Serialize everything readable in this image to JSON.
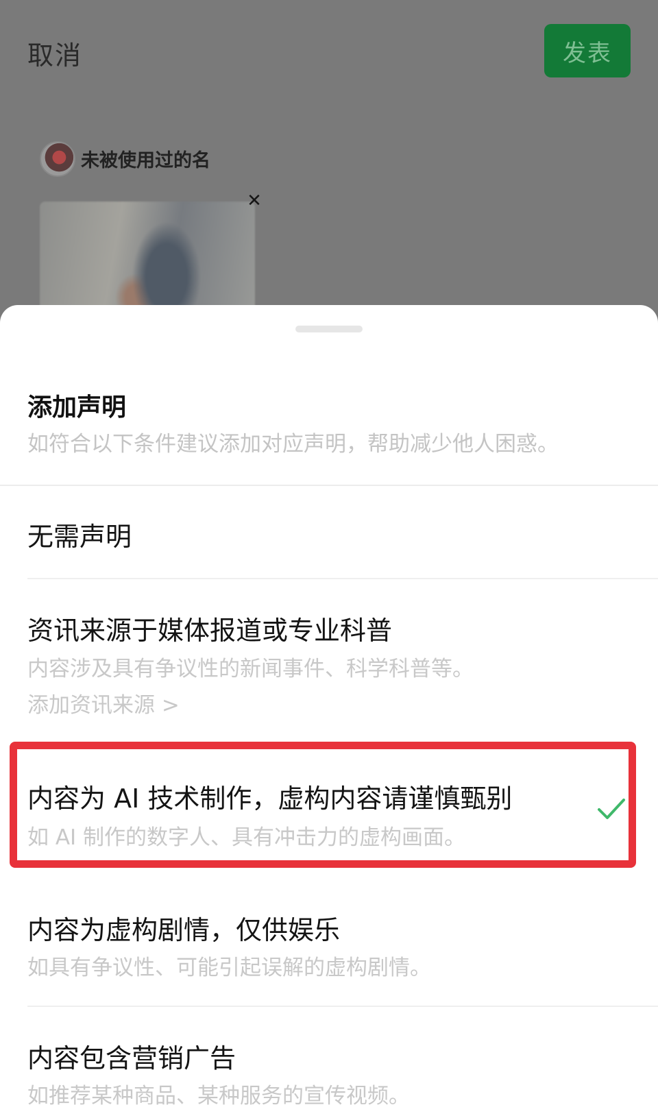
{
  "composer": {
    "cancel_label": "取消",
    "publish_label": "发表",
    "username": "未被使用过的名",
    "remove_icon": "close-icon",
    "accent_color": "#137a37"
  },
  "sheet": {
    "title": "添加声明",
    "subtitle": "如符合以下条件建议添加对应声明，帮助减少他人困惑。",
    "options": [
      {
        "title": "无需声明",
        "description": "",
        "link": "",
        "selected": false
      },
      {
        "title": "资讯来源于媒体报道或专业科普",
        "description": "内容涉及具有争议性的新闻事件、科学科普等。",
        "link": "添加资讯来源 >",
        "selected": false
      },
      {
        "title": "内容为 AI 技术制作，虚构内容请谨慎甄别",
        "description": "如 AI 制作的数字人、具有冲击力的虚构画面。",
        "link": "",
        "selected": true
      },
      {
        "title": "内容为虚构剧情，仅供娱乐",
        "description": "如具有争议性、可能引起误解的虚构剧情。",
        "link": "",
        "selected": false
      },
      {
        "title": "内容包含营销广告",
        "description": "如推荐某种商品、某种服务的宣传视频。",
        "link": "",
        "selected": false
      }
    ],
    "selected_icon": "checkmark-icon",
    "check_color": "#3fb86a",
    "highlight_color": "#e8323a"
  }
}
